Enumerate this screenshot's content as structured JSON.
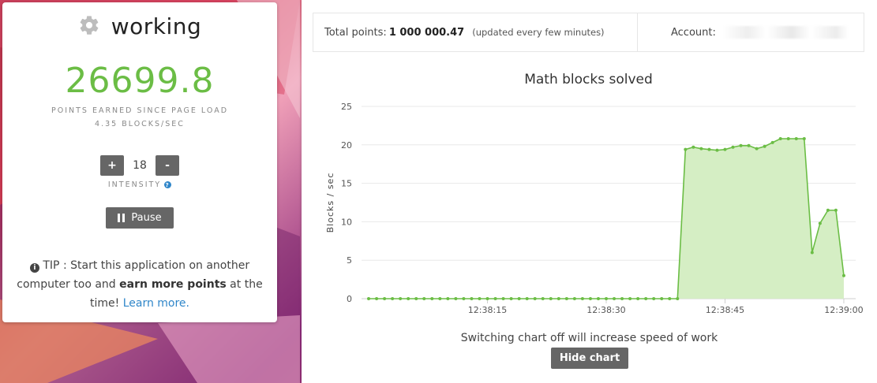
{
  "status": {
    "icon": "gear-icon",
    "text": "working"
  },
  "points": {
    "value": "26699.8",
    "label": "POINTS EARNED SINCE PAGE LOAD",
    "rate": "4.35 BLOCKS/SEC"
  },
  "intensity": {
    "plus_label": "+",
    "value": "18",
    "minus_label": "-",
    "label": "INTENSITY",
    "help_glyph": "?"
  },
  "pause_button": {
    "label": "Pause",
    "icon": "pause-icon"
  },
  "tip": {
    "prefix": "TIP : Start this application on another computer too and ",
    "bold": "earn more points",
    "middle": " at the time! ",
    "link": "Learn more.",
    "icon": "info-icon"
  },
  "topbar": {
    "total_label": "Total points:",
    "total_value": "1 000 000.47",
    "total_note": "(updated every few minutes)",
    "account_label": "Account:"
  },
  "chart_footer": "Switching chart off will increase speed of work",
  "hide_chart_label": "Hide chart",
  "colors": {
    "accent_green": "#6bbd45",
    "fill_green": "#d5eec4",
    "button_gray": "#666666",
    "link_blue": "#2f86c9"
  },
  "chart_data": {
    "type": "area",
    "title": "Math blocks solved",
    "ylabel": "Blocks / sec",
    "xlabel": "",
    "ylim": [
      0,
      25
    ],
    "yticks": [
      0,
      5,
      10,
      15,
      20,
      25
    ],
    "xticks": [
      {
        "t": 15,
        "label": "12:38:15"
      },
      {
        "t": 30,
        "label": "12:38:30"
      },
      {
        "t": 45,
        "label": "12:38:45"
      },
      {
        "t": 60,
        "label": "12:39:00"
      }
    ],
    "xlim": [
      -0.9,
      61.5
    ],
    "grid": true,
    "series": [
      {
        "x": [
          0,
          1,
          2,
          3,
          4,
          5,
          6,
          7,
          8,
          9,
          10,
          11,
          12,
          13,
          14,
          15,
          16,
          17,
          18,
          19,
          20,
          21,
          22,
          23,
          24,
          25,
          26,
          27,
          28,
          29,
          30,
          31,
          32,
          33,
          34,
          35,
          36,
          37,
          38,
          39,
          40,
          41,
          42,
          43,
          44,
          45,
          46,
          47,
          48,
          49,
          50,
          51,
          52,
          53,
          54,
          55,
          56,
          57,
          58,
          59,
          60
        ],
        "values": [
          0,
          0,
          0,
          0,
          0,
          0,
          0,
          0,
          0,
          0,
          0,
          0,
          0,
          0,
          0,
          0,
          0,
          0,
          0,
          0,
          0,
          0,
          0,
          0,
          0,
          0,
          0,
          0,
          0,
          0,
          0,
          0,
          0,
          0,
          0,
          0,
          0,
          0,
          0,
          0,
          19.4,
          19.7,
          19.5,
          19.4,
          19.3,
          19.4,
          19.7,
          19.9,
          19.9,
          19.5,
          19.8,
          20.3,
          20.8,
          20.8,
          20.8,
          20.8,
          6.0,
          9.8,
          11.5,
          11.5,
          3.0
        ]
      }
    ]
  }
}
